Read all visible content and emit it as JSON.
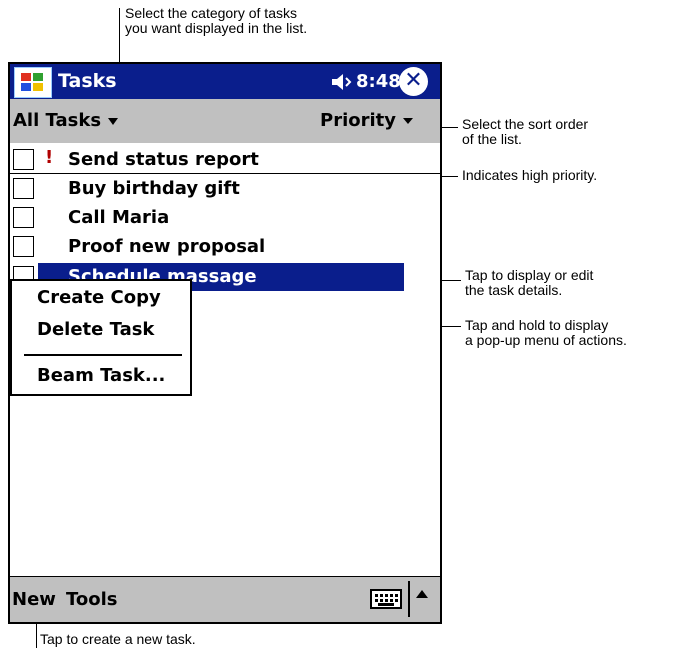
{
  "callouts": {
    "category": "Select the category of tasks\nyou want displayed in the list.",
    "sort": "Select the sort order\nof the list.",
    "priority": "Indicates high priority.",
    "edit": "Tap to display or edit\nthe task details.",
    "popup": "Tap and hold to display\na pop-up menu of actions.",
    "new": "Tap to create a new task."
  },
  "titlebar": {
    "title": "Tasks",
    "time": "8:48",
    "close_glyph": "✕"
  },
  "filterbar": {
    "category": "All Tasks",
    "sort": "Priority"
  },
  "tasks": [
    {
      "label": "Send status report",
      "priority_mark": "!"
    },
    {
      "label": "Buy birthday gift",
      "priority_mark": ""
    },
    {
      "label": "Call Maria",
      "priority_mark": ""
    },
    {
      "label": "Proof new proposal",
      "priority_mark": ""
    },
    {
      "label": "Schedule massage",
      "priority_mark": ""
    }
  ],
  "popup_menu": {
    "item1": "Create Copy",
    "item2": "Delete Task",
    "item3": "Beam Task..."
  },
  "menubar": {
    "new": "New",
    "tools": "Tools"
  },
  "colors": {
    "titlebar": "#0a1e8c",
    "bars": "#c0c0c0",
    "priority": "#b00000"
  }
}
